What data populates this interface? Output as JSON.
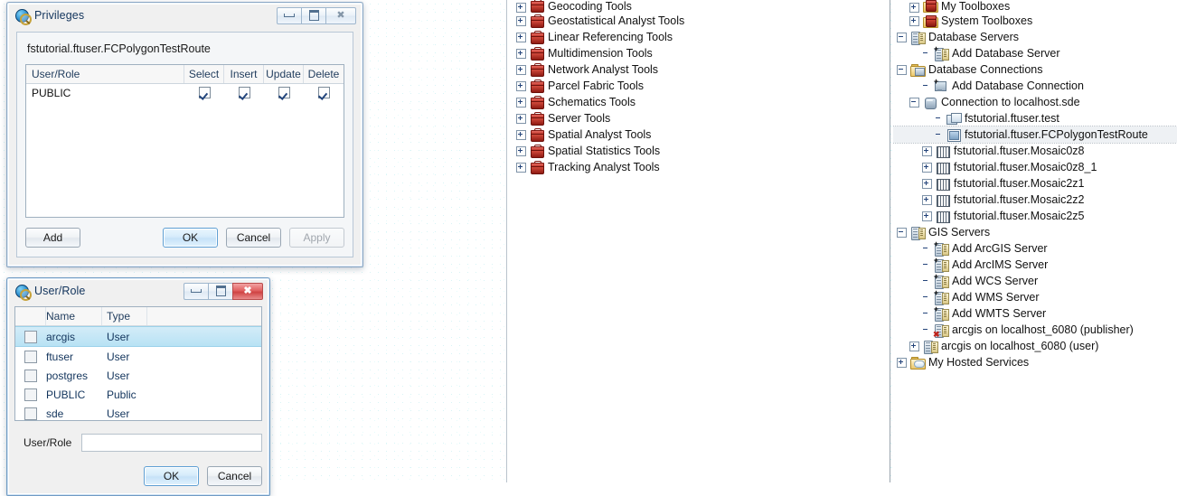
{
  "privileges_dialog": {
    "title": "Privileges",
    "icon": "arcgis-globe-icon",
    "object_name": "fstutorial.ftuser.FCPolygonTestRoute",
    "window_buttons": {
      "minimize": "minimize-icon",
      "maximize": "maximize-icon",
      "close": "close-icon"
    },
    "grid": {
      "columns": [
        "User/Role",
        "Select",
        "Insert",
        "Update",
        "Delete"
      ],
      "rows": [
        {
          "user_role": "PUBLIC",
          "select": true,
          "insert": true,
          "update": true,
          "delete": true
        }
      ]
    },
    "buttons": {
      "add": "Add",
      "ok": "OK",
      "cancel": "Cancel",
      "apply": "Apply",
      "apply_enabled": false,
      "ok_is_default": true
    }
  },
  "userrole_dialog": {
    "title": "User/Role",
    "icon": "arcgis-globe-icon",
    "window_buttons": {
      "minimize": "minimize-icon",
      "maximize": "maximize-icon",
      "close": "close-icon"
    },
    "list": {
      "columns": [
        "",
        "Name",
        "Type"
      ],
      "rows": [
        {
          "checked": false,
          "name": "arcgis",
          "type": "User",
          "selected": true
        },
        {
          "checked": false,
          "name": "ftuser",
          "type": "User",
          "selected": false
        },
        {
          "checked": false,
          "name": "postgres",
          "type": "User",
          "selected": false
        },
        {
          "checked": false,
          "name": "PUBLIC",
          "type": "Public",
          "selected": false
        },
        {
          "checked": false,
          "name": "sde",
          "type": "User",
          "selected": false
        }
      ]
    },
    "field": {
      "label": "User/Role",
      "value": "",
      "placeholder": ""
    },
    "buttons": {
      "ok": "OK",
      "cancel": "Cancel",
      "ok_is_default": true
    }
  },
  "toolboxes_panel": {
    "items": [
      {
        "label": "Geocoding Tools",
        "icon": "toolbox-icon",
        "expander": "plus",
        "clipped": true
      },
      {
        "label": "Geostatistical Analyst Tools",
        "icon": "toolbox-icon",
        "expander": "plus"
      },
      {
        "label": "Linear Referencing Tools",
        "icon": "toolbox-icon",
        "expander": "plus"
      },
      {
        "label": "Multidimension Tools",
        "icon": "toolbox-icon",
        "expander": "plus"
      },
      {
        "label": "Network Analyst Tools",
        "icon": "toolbox-icon",
        "expander": "plus"
      },
      {
        "label": "Parcel Fabric Tools",
        "icon": "toolbox-icon",
        "expander": "plus"
      },
      {
        "label": "Schematics Tools",
        "icon": "toolbox-icon",
        "expander": "plus"
      },
      {
        "label": "Server Tools",
        "icon": "toolbox-icon",
        "expander": "plus"
      },
      {
        "label": "Spatial Analyst Tools",
        "icon": "toolbox-icon",
        "expander": "plus"
      },
      {
        "label": "Spatial Statistics Tools",
        "icon": "toolbox-icon",
        "expander": "plus"
      },
      {
        "label": "Tracking Analyst Tools",
        "icon": "toolbox-icon",
        "expander": "plus"
      }
    ]
  },
  "catalog_panel": {
    "items": [
      {
        "label": "My Toolboxes",
        "icon": "toolbox-folder-icon",
        "expander": "plus",
        "indent": 1,
        "clipped": true
      },
      {
        "label": "System Toolboxes",
        "icon": "toolbox-folder-icon",
        "expander": "plus",
        "indent": 1
      },
      {
        "label": "Database Servers",
        "icon": "server-icon",
        "expander": "minus",
        "indent": 0
      },
      {
        "label": "Add Database Server",
        "icon": "add-server-icon",
        "expander": "none",
        "indent": 2
      },
      {
        "label": "Database Connections",
        "icon": "folder-connection-icon",
        "expander": "minus",
        "indent": 0
      },
      {
        "label": "Add Database Connection",
        "icon": "add-connection-icon",
        "expander": "none",
        "indent": 2
      },
      {
        "label": "Connection to localhost.sde",
        "icon": "database-connection-icon",
        "expander": "minus",
        "indent": 1
      },
      {
        "label": "fstutorial.ftuser.test",
        "icon": "table-icon",
        "expander": "none",
        "indent": 3
      },
      {
        "label": "fstutorial.ftuser.FCPolygonTestRoute",
        "icon": "feature-class-icon",
        "expander": "none",
        "indent": 3,
        "selected": true
      },
      {
        "label": "fstutorial.ftuser.Mosaic0z8",
        "icon": "mosaic-dataset-icon",
        "expander": "plus",
        "indent": 2
      },
      {
        "label": "fstutorial.ftuser.Mosaic0z8_1",
        "icon": "mosaic-dataset-icon",
        "expander": "plus",
        "indent": 2
      },
      {
        "label": "fstutorial.ftuser.Mosaic2z1",
        "icon": "mosaic-dataset-icon",
        "expander": "plus",
        "indent": 2
      },
      {
        "label": "fstutorial.ftuser.Mosaic2z2",
        "icon": "mosaic-dataset-icon",
        "expander": "plus",
        "indent": 2
      },
      {
        "label": "fstutorial.ftuser.Mosaic2z5",
        "icon": "mosaic-dataset-icon",
        "expander": "plus",
        "indent": 2
      },
      {
        "label": "GIS Servers",
        "icon": "server-icon",
        "expander": "minus",
        "indent": 0
      },
      {
        "label": "Add ArcGIS Server",
        "icon": "add-server-icon",
        "expander": "none",
        "indent": 2
      },
      {
        "label": "Add ArcIMS Server",
        "icon": "add-server-icon",
        "expander": "none",
        "indent": 2
      },
      {
        "label": "Add WCS Server",
        "icon": "add-server-icon",
        "expander": "none",
        "indent": 2
      },
      {
        "label": "Add WMS Server",
        "icon": "add-server-icon",
        "expander": "none",
        "indent": 2
      },
      {
        "label": "Add WMTS Server",
        "icon": "add-server-icon",
        "expander": "none",
        "indent": 2
      },
      {
        "label": "arcgis on localhost_6080 (publisher)",
        "icon": "server-disconnected-icon",
        "expander": "none",
        "indent": 2
      },
      {
        "label": "arcgis on localhost_6080 (user)",
        "icon": "server-icon-small",
        "expander": "plus",
        "indent": 1
      },
      {
        "label": "My Hosted Services",
        "icon": "folder-cloud-icon",
        "expander": "plus",
        "indent": 0
      }
    ]
  }
}
